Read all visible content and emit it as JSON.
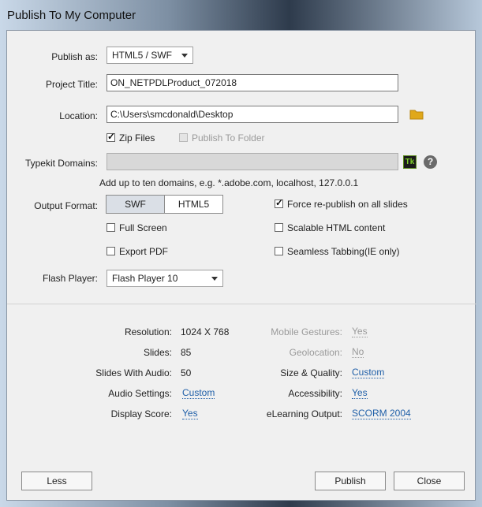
{
  "window": {
    "title": "Publish To My Computer"
  },
  "form": {
    "publish_as_label": "Publish as:",
    "publish_as_value": "HTML5 / SWF",
    "project_title_label": "Project Title:",
    "project_title_value": "ON_NETPDLProduct_072018",
    "location_label": "Location:",
    "location_value": "C:\\Users\\smcdonald\\Desktop",
    "zip_files_label": "Zip Files",
    "publish_to_folder_label": "Publish To Folder",
    "typekit_label": "Typekit Domains:",
    "typekit_value": "",
    "typekit_badge": "Tk",
    "typekit_hint": "Add up to ten domains, e.g. *.adobe.com, localhost, 127.0.0.1",
    "output_format_label": "Output Format:",
    "output_swf": "SWF",
    "output_html5": "HTML5",
    "force_republish_label": "Force re-publish on all slides",
    "full_screen_label": "Full Screen",
    "scalable_html_label": "Scalable HTML content",
    "export_pdf_label": "Export PDF",
    "seamless_tabbing_label": "Seamless Tabbing(IE only)",
    "flash_player_label": "Flash Player:",
    "flash_player_value": "Flash Player 10"
  },
  "summary": {
    "resolution_label": "Resolution:",
    "resolution_value": "1024 X 768",
    "slides_label": "Slides:",
    "slides_value": "85",
    "slides_audio_label": "Slides With Audio:",
    "slides_audio_value": "50",
    "audio_settings_label": "Audio Settings:",
    "audio_settings_value": "Custom",
    "display_score_label": "Display Score:",
    "display_score_value": "Yes",
    "mobile_gestures_label": "Mobile Gestures:",
    "mobile_gestures_value": "Yes",
    "geolocation_label": "Geolocation:",
    "geolocation_value": "No",
    "size_quality_label": "Size & Quality:",
    "size_quality_value": "Custom",
    "accessibility_label": "Accessibility:",
    "accessibility_value": "Yes",
    "elearning_label": "eLearning Output:",
    "elearning_value": "SCORM 2004"
  },
  "buttons": {
    "less": "Less",
    "publish": "Publish",
    "close": "Close"
  },
  "colors": {
    "link": "#1f5fa8",
    "folder_icon": "#e0a81a",
    "typekit_badge_bg": "#1a1a1a",
    "typekit_badge_fg": "#7fd12a"
  }
}
